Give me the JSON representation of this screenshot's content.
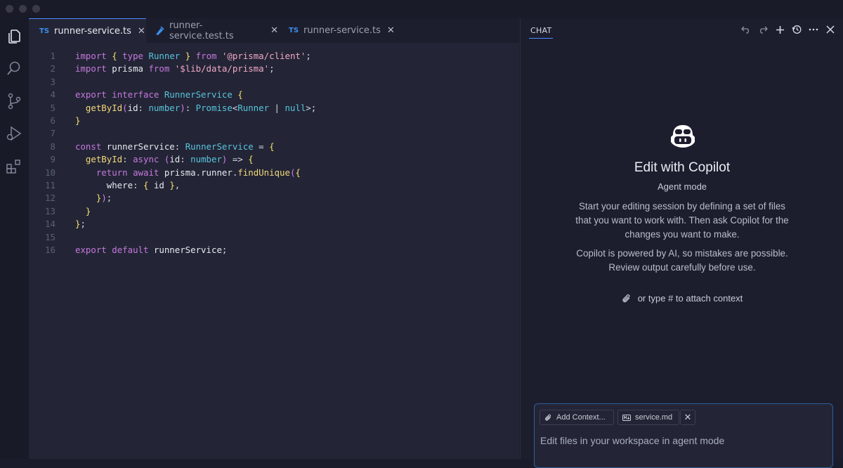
{
  "tabs": [
    {
      "badge": "TS",
      "label": "runner-service.ts",
      "active": true
    },
    {
      "badge": "test",
      "label": "runner-service.test.ts",
      "active": false
    },
    {
      "badge": "TS",
      "label": "runner-service.ts",
      "active": false
    }
  ],
  "code": {
    "line_numbers": [
      "1",
      "2",
      "3",
      "4",
      "5",
      "6",
      "7",
      "8",
      "9",
      "10",
      "11",
      "12",
      "13",
      "14",
      "15",
      "16"
    ],
    "lines": [
      "import { type Runner } from '@prisma/client';",
      "import prisma from '$lib/data/prisma';",
      "",
      "export interface RunnerService {",
      "  getById(id: number): Promise<Runner | null>;",
      "}",
      "",
      "const runnerService: RunnerService = {",
      "  getById: async (id: number) => {",
      "    return await prisma.runner.findUnique({",
      "      where: { id },",
      "    });",
      "  }",
      "};",
      "",
      "export default runnerService;"
    ]
  },
  "chat": {
    "header_title": "CHAT",
    "header_actions": [
      "undo-icon",
      "redo-icon",
      "plus-icon",
      "history-icon",
      "more-icon",
      "close-icon"
    ],
    "title": "Edit with Copilot",
    "subtitle": "Agent mode",
    "description": "Start your editing session by defining a set of files that you want to work with. Then ask Copilot for the changes you want to make.",
    "disclaimer": "Copilot is powered by AI, so mistakes are possible. Review output carefully before use.",
    "attach_hint": "or type # to attach context",
    "add_context_label": "Add Context...",
    "file_chip_label": "service.md",
    "input_placeholder": "Edit files in your workspace in agent mode"
  },
  "colors": {
    "accent": "#4a8cff",
    "ts_badge": "#3b8eea",
    "keyword": "#c678dd",
    "string": "#f0a8c8",
    "type": "#58c4dc"
  }
}
